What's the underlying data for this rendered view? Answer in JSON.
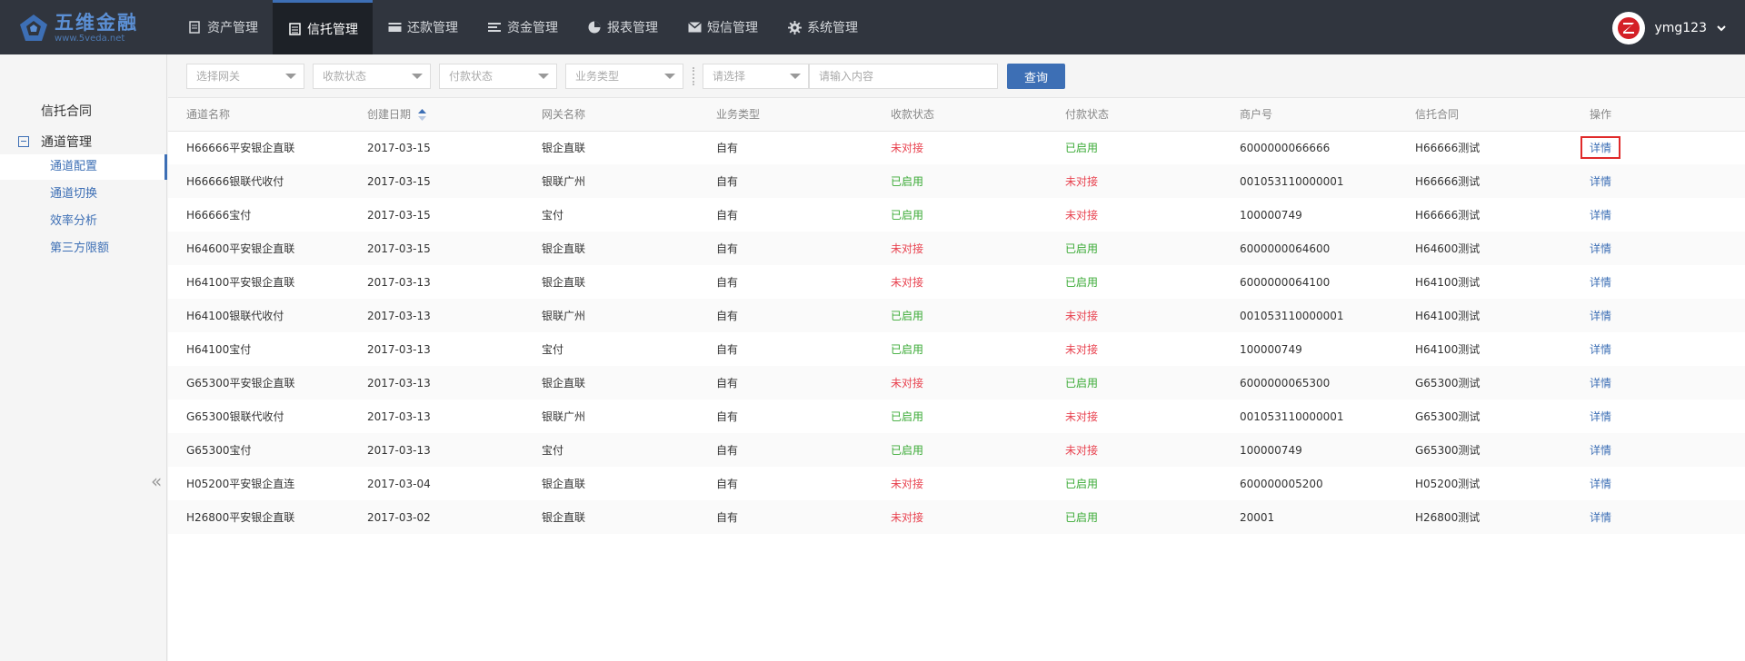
{
  "logo": {
    "brand": "五维金融",
    "url": "www.5veda.net"
  },
  "nav": [
    {
      "label": "资产管理",
      "icon": "asset-icon"
    },
    {
      "label": "信托管理",
      "icon": "trust-icon",
      "active": true
    },
    {
      "label": "还款管理",
      "icon": "repay-icon"
    },
    {
      "label": "资金管理",
      "icon": "fund-icon"
    },
    {
      "label": "报表管理",
      "icon": "report-icon"
    },
    {
      "label": "短信管理",
      "icon": "sms-icon"
    },
    {
      "label": "系统管理",
      "icon": "gear-icon"
    }
  ],
  "user": {
    "name": "ymg123"
  },
  "sidebar": {
    "top_item": "信托合同",
    "group": "通道管理",
    "subitems": [
      "通道配置",
      "通道切换",
      "效率分析",
      "第三方限额"
    ],
    "active_index": 0
  },
  "filters": {
    "gateway": "选择网关",
    "receive_status": "收款状态",
    "pay_status": "付款状态",
    "biz_type": "业务类型",
    "select": "请选择",
    "input_placeholder": "请输入内容",
    "query_label": "查询"
  },
  "table": {
    "columns": [
      "通道名称",
      "创建日期",
      "网关名称",
      "业务类型",
      "收款状态",
      "付款状态",
      "商户号",
      "信托合同",
      "操作"
    ],
    "rows": [
      [
        "H66666平安银企直联",
        "2017-03-15",
        "银企直联",
        "自有",
        "未对接",
        "已启用",
        "6000000066666",
        "H66666测试",
        "详情"
      ],
      [
        "H66666银联代收付",
        "2017-03-15",
        "银联广州",
        "自有",
        "已启用",
        "未对接",
        "001053110000001",
        "H66666测试",
        "详情"
      ],
      [
        "H66666宝付",
        "2017-03-15",
        "宝付",
        "自有",
        "已启用",
        "未对接",
        "100000749",
        "H66666测试",
        "详情"
      ],
      [
        "H64600平安银企直联",
        "2017-03-15",
        "银企直联",
        "自有",
        "未对接",
        "已启用",
        "6000000064600",
        "H64600测试",
        "详情"
      ],
      [
        "H64100平安银企直联",
        "2017-03-13",
        "银企直联",
        "自有",
        "未对接",
        "已启用",
        "6000000064100",
        "H64100测试",
        "详情"
      ],
      [
        "H64100银联代收付",
        "2017-03-13",
        "银联广州",
        "自有",
        "已启用",
        "未对接",
        "001053110000001",
        "H64100测试",
        "详情"
      ],
      [
        "H64100宝付",
        "2017-03-13",
        "宝付",
        "自有",
        "已启用",
        "未对接",
        "100000749",
        "H64100测试",
        "详情"
      ],
      [
        "G65300平安银企直联",
        "2017-03-13",
        "银企直联",
        "自有",
        "未对接",
        "已启用",
        "6000000065300",
        "G65300测试",
        "详情"
      ],
      [
        "G65300银联代收付",
        "2017-03-13",
        "银联广州",
        "自有",
        "已启用",
        "未对接",
        "001053110000001",
        "G65300测试",
        "详情"
      ],
      [
        "G65300宝付",
        "2017-03-13",
        "宝付",
        "自有",
        "已启用",
        "未对接",
        "100000749",
        "G65300测试",
        "详情"
      ],
      [
        "H05200平安银企直连",
        "2017-03-04",
        "银企直联",
        "自有",
        "未对接",
        "已启用",
        "600000005200",
        "H05200测试",
        "详情"
      ],
      [
        "H26800平安银企直联",
        "2017-03-02",
        "银企直联",
        "自有",
        "未对接",
        "已启用",
        "20001",
        "H26800测试",
        "详情"
      ]
    ]
  },
  "colors": {
    "accent": "#3d6fb5",
    "topbar": "#30353e",
    "status_off": "#e8424f",
    "status_on": "#3aaa35",
    "highlight": "#e02a2a"
  }
}
